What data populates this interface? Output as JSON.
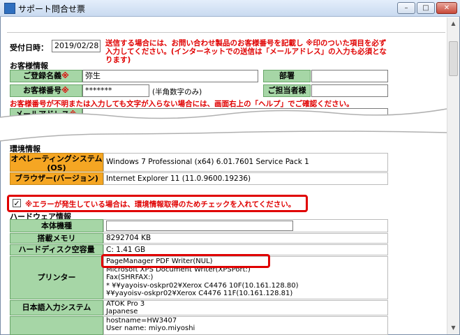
{
  "window": {
    "title": "サポート問合せ票",
    "minimize": "–",
    "maximize": "□",
    "close": "✕"
  },
  "reception": {
    "label": "受付日時：",
    "date": "2019/02/28"
  },
  "notice": "送信する場合には、お問い合わせ製品のお客様番号を記載し ※印のついた項目を必ず入力してください。(インターネットでの送信は「メールアドレス」の入力も必須となります)",
  "customer": {
    "section": "お客様情報",
    "name_label": "ご登録名義",
    "name_value": "弥生",
    "dept_label": "部署",
    "number_label": "お客様番号",
    "number_value": "*******",
    "number_hint": "(半角数字のみ)",
    "contact_label": "ご担当者様",
    "req_mark": "※",
    "help_notice": "お客様番号が不明または入力しても文字が入らない場合には、画面右上の「ヘルプ」でご確認ください。",
    "mail_label": "メールアドレス"
  },
  "env": {
    "section": "環境情報",
    "os_label_1": "オペレーティングシステム",
    "os_label_2": "(OS)",
    "os_value": "Windows 7 Professional (x64) 6.01.7601 Service Pack 1",
    "browser_label": "ブラウザー(バージョン)",
    "browser_value": "Internet Explorer 11 (11.0.9600.19236)"
  },
  "error_check": {
    "checked": true,
    "checkmark": "✓",
    "text": "※エラーが発生している場合は、環境情報取得のためチェックを入れてください。"
  },
  "hardware": {
    "section": "ハードウェア情報",
    "model_label": "本体機種",
    "model_value": "",
    "memory_label": "搭載メモリ",
    "memory_value": "8292704 KB",
    "disk_label": "ハードディスク空容量",
    "disk_value": "C: 1.41 GB",
    "printer_label": "プリンター",
    "printers": [
      "PageManager PDF Writer(NUL)",
      "Microsoft XPS Document Writer(XPSPort:)",
      "Fax(SHRFAX:)",
      "* ¥¥yayoisv-oskpr02¥Xerox C4476 10F(10.161.128.80)",
      "¥¥yayoisv-oskpr02¥Xerox C4476 11F(10.161.128.81)"
    ],
    "ime_label": "日本語入力システム",
    "ime_value_1": "ATOK Pro 3",
    "ime_value_2": "Japanese",
    "host_value": "hostname=HW3407",
    "user_value": "User name: miyo.miyoshi"
  }
}
